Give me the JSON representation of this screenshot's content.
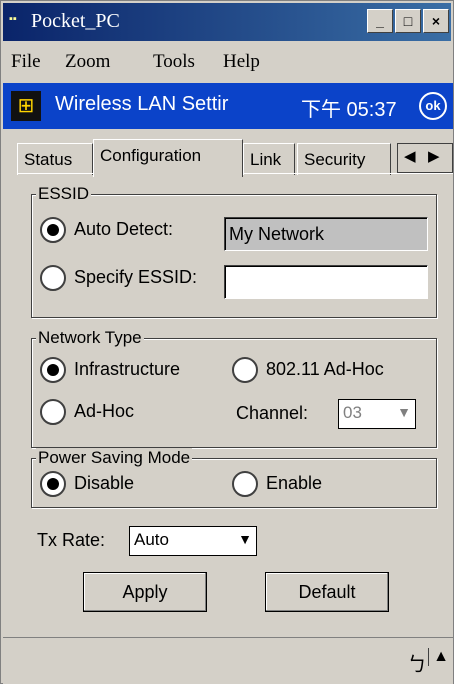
{
  "window": {
    "title": "Pocket_PC"
  },
  "window_buttons": {
    "minimize": "_",
    "maximize": "□",
    "close": "×"
  },
  "menu": {
    "file": "File",
    "zoom": "Zoom",
    "tools": "Tools",
    "help": "Help"
  },
  "navbar": {
    "title": "Wireless LAN Settir",
    "time": "下午 05:37",
    "ok": "ok"
  },
  "tabs": [
    "Status",
    "Configuration",
    "Link",
    "Security"
  ],
  "tab_arrows": {
    "left": "◀",
    "right": "▶"
  },
  "essid": {
    "group_label": "ESSID",
    "auto_detect_label": "Auto Detect:",
    "auto_detect_value": "My Network",
    "specify_label": "Specify ESSID:",
    "specify_value": ""
  },
  "network_type": {
    "group_label": "Network Type",
    "infrastructure": "Infrastructure",
    "adhoc_80211": "802.11 Ad-Hoc",
    "adhoc": "Ad-Hoc",
    "channel_label": "Channel:",
    "channel_value": "03"
  },
  "power": {
    "group_label": "Power Saving Mode",
    "disable": "Disable",
    "enable": "Enable"
  },
  "tx_rate": {
    "label": "Tx Rate:",
    "value": "Auto"
  },
  "buttons": {
    "apply": "Apply",
    "default": "Default"
  },
  "statusbar": {
    "keyboard": "ㄅ",
    "up": "▲"
  }
}
